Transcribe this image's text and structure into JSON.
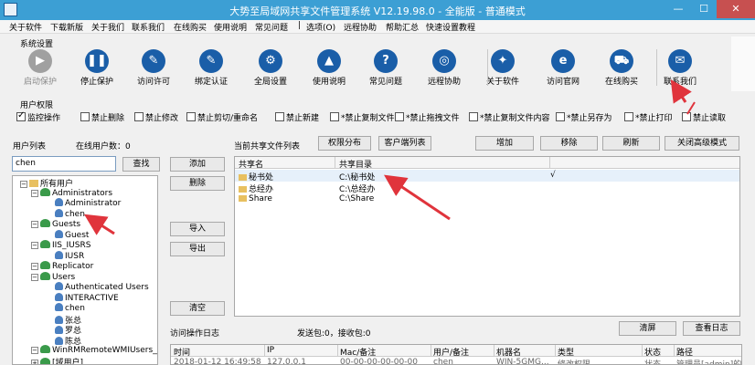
{
  "window": {
    "title": "大势至局域网共享文件管理系统 V12.19.98.0 - 全能版 - 普通模式",
    "min": "—",
    "max": "☐",
    "close": "✕"
  },
  "menu": [
    "关于软件",
    "下载新版",
    "关于我们",
    "联系我们",
    "在线购买",
    "使用说明",
    "常见问题",
    "|",
    "选项(O)",
    "远程协助",
    "帮助汇总",
    "快速设置教程"
  ],
  "system_settings": {
    "label": "系统设置",
    "buttons": [
      {
        "label": "启动保护",
        "icon": "power-icon",
        "glyph": "▶",
        "color": "#a0a0a0",
        "disabled": true
      },
      {
        "label": "停止保护",
        "icon": "pause-icon",
        "glyph": "❚❚",
        "color": "#1a5ea8"
      },
      {
        "label": "访问许可",
        "icon": "key-icon",
        "glyph": "✎",
        "color": "#1a5ea8"
      },
      {
        "label": "绑定认证",
        "icon": "bind-icon",
        "glyph": "✎",
        "color": "#1a5ea8"
      },
      {
        "label": "全局设置",
        "icon": "gear-icon",
        "glyph": "⚙",
        "color": "#1a5ea8"
      },
      {
        "label": "使用说明",
        "icon": "graduation-cap-icon",
        "glyph": "▲",
        "color": "#1a5ea8"
      },
      {
        "label": "常见问题",
        "icon": "question-icon",
        "glyph": "?",
        "color": "#1a5ea8"
      },
      {
        "label": "远程协助",
        "icon": "gamepad-icon",
        "glyph": "◎",
        "color": "#1a5ea8"
      },
      {
        "label": "关于软件",
        "icon": "puzzle-icon",
        "glyph": "✦",
        "color": "#1a5ea8"
      },
      {
        "label": "访问官网",
        "icon": "ie-icon",
        "glyph": "e",
        "color": "#1a5ea8"
      },
      {
        "label": "在线购买",
        "icon": "cart-icon",
        "glyph": "⛟",
        "color": "#1a5ea8"
      },
      {
        "label": "联系我们",
        "icon": "contact-icon",
        "glyph": "✉",
        "color": "#1a5ea8"
      }
    ]
  },
  "user_permissions": {
    "label": "用户权限",
    "items": [
      {
        "label": "监控操作",
        "checked": true
      },
      {
        "label": "禁止删除",
        "checked": false
      },
      {
        "label": "禁止修改",
        "checked": false
      },
      {
        "label": "禁止剪切/重命名",
        "checked": false
      },
      {
        "label": "禁止新建",
        "checked": false
      },
      {
        "label": "*禁止复制文件",
        "checked": false
      },
      {
        "label": "*禁止拖拽文件",
        "checked": false
      },
      {
        "label": "*禁止复制文件内容",
        "checked": false
      },
      {
        "label": "*禁止另存为",
        "checked": false
      },
      {
        "label": "*禁止打印",
        "checked": false
      },
      {
        "label": "禁止读取",
        "checked": false
      }
    ]
  },
  "user_list": {
    "label": "用户列表",
    "online_count": "在线用户数：0",
    "search_value": "chen",
    "search_button": "查找",
    "tree": [
      {
        "text": "所有用户",
        "kind": "root",
        "toggle": "−"
      },
      {
        "text": "Administrators",
        "kind": "group",
        "toggle": "−"
      },
      {
        "text": "Administrator",
        "kind": "user"
      },
      {
        "text": "chen",
        "kind": "user"
      },
      {
        "text": "Guests",
        "kind": "group",
        "toggle": "−"
      },
      {
        "text": "Guest",
        "kind": "user"
      },
      {
        "text": "IIS_IUSRS",
        "kind": "group",
        "toggle": "−"
      },
      {
        "text": "IUSR",
        "kind": "user"
      },
      {
        "text": "Replicator",
        "kind": "group",
        "toggle": "−"
      },
      {
        "text": "Users",
        "kind": "group",
        "toggle": "−"
      },
      {
        "text": "Authenticated Users",
        "kind": "user"
      },
      {
        "text": "INTERACTIVE",
        "kind": "user"
      },
      {
        "text": "chen",
        "kind": "user"
      },
      {
        "text": "张总",
        "kind": "user"
      },
      {
        "text": "罗总",
        "kind": "user"
      },
      {
        "text": "陈总",
        "kind": "user"
      },
      {
        "text": "WinRMRemoteWMIUsers__",
        "kind": "group",
        "toggle": "−"
      },
      {
        "text": "[域用户]",
        "kind": "group",
        "toggle": "+"
      }
    ]
  },
  "middle_buttons": {
    "add": "添加",
    "delete": "删除",
    "import": "导入",
    "export": "导出",
    "clear": "清空"
  },
  "share_list": {
    "label": "当前共享文件列表",
    "perm_dist": "权限分布",
    "client_list": "客户端列表",
    "add": "增加",
    "remove": "移除",
    "refresh": "刷新",
    "close_advanced": "关闭高级模式",
    "columns": [
      "共享名",
      "共享目录"
    ],
    "rows": [
      {
        "name": "秘书处",
        "path": "C:\\秘书处",
        "mark": "√"
      },
      {
        "name": "总经办",
        "path": "C:\\总经办",
        "mark": ""
      },
      {
        "name": "Share",
        "path": "C:\\Share",
        "mark": ""
      }
    ]
  },
  "access_log": {
    "label": "访问操作日志",
    "packets": "发送包:0，接收包:0",
    "clear": "清屏",
    "view": "查看日志",
    "columns": [
      "时间",
      "IP",
      "Mac/备注",
      "用户/备注",
      "机器名",
      "类型",
      "状态",
      "路径"
    ],
    "rows": [
      [
        "2018-01-12 16:49:58",
        "127.0.0.1",
        "00-00-00-00-00-00",
        "chen",
        "WIN-5GMG...",
        "修改权限",
        "状态",
        "管理员[admin]的"
      ]
    ]
  },
  "colors": {
    "titlebar": "#3c9fd4",
    "accent_arrow": "#e0343c",
    "toolbar_icon": "#1a5ea8"
  }
}
